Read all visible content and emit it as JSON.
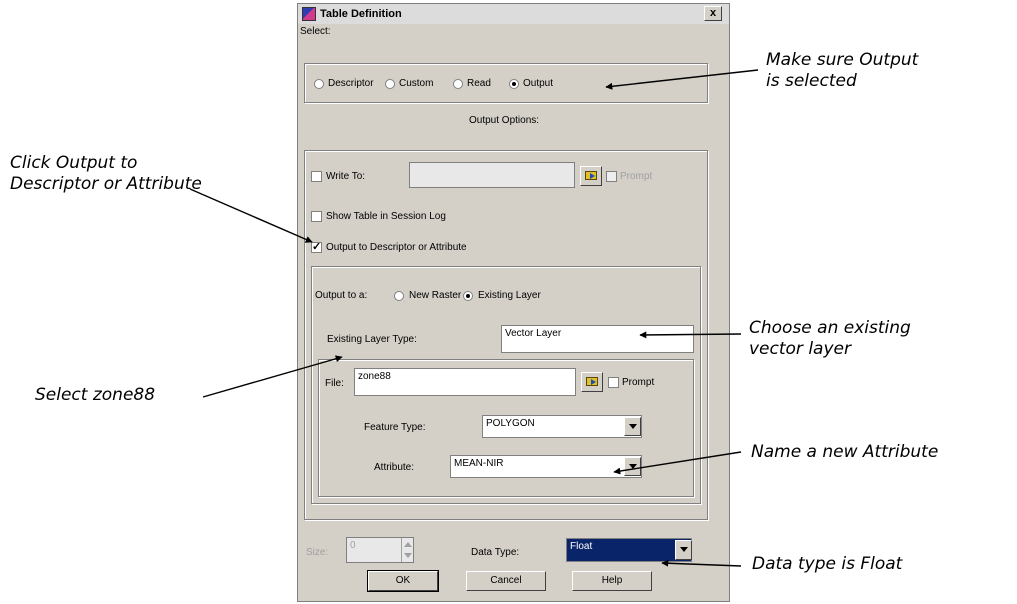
{
  "dialog": {
    "title": "Table Definition",
    "close_label": "x",
    "select_label": "Select:",
    "select_options": [
      "Descriptor",
      "Custom",
      "Read",
      "Output"
    ],
    "output_options_label": "Output Options:",
    "write_to_label": "Write To:",
    "write_to_value": "",
    "prompt_label": "Prompt",
    "show_table_label": "Show Table in Session Log",
    "output_to_descriptor_label": "Output to Descriptor or Attribute",
    "output_to_label": "Output to a:",
    "new_raster_label": "New Raster",
    "existing_layer_label": "Existing Layer",
    "existing_layer_type_label": "Existing Layer Type:",
    "existing_layer_type_value": "Vector Layer",
    "file_label": "File:",
    "file_value": "zone88",
    "file_prompt_label": "Prompt",
    "feature_type_label": "Feature Type:",
    "feature_type_value": "POLYGON",
    "attribute_label": "Attribute:",
    "attribute_value": "MEAN-NIR",
    "size_label": "Size:",
    "size_value": "0",
    "data_type_label": "Data Type:",
    "data_type_value": "Float",
    "ok_label": "OK",
    "cancel_label": "Cancel",
    "help_label": "Help"
  },
  "annotations": {
    "output_selected": [
      "Make sure Output",
      "is selected"
    ],
    "click_output": [
      "Click Output to",
      "Descriptor or Attribute"
    ],
    "choose_layer": [
      "Choose an existing",
      "vector layer"
    ],
    "select_zone": "Select zone88",
    "name_attribute": "Name a new Attribute",
    "data_type": "Data type is Float"
  },
  "colors": {
    "dialog_bg": "#d4d0c8",
    "selection": "#0a246a"
  }
}
